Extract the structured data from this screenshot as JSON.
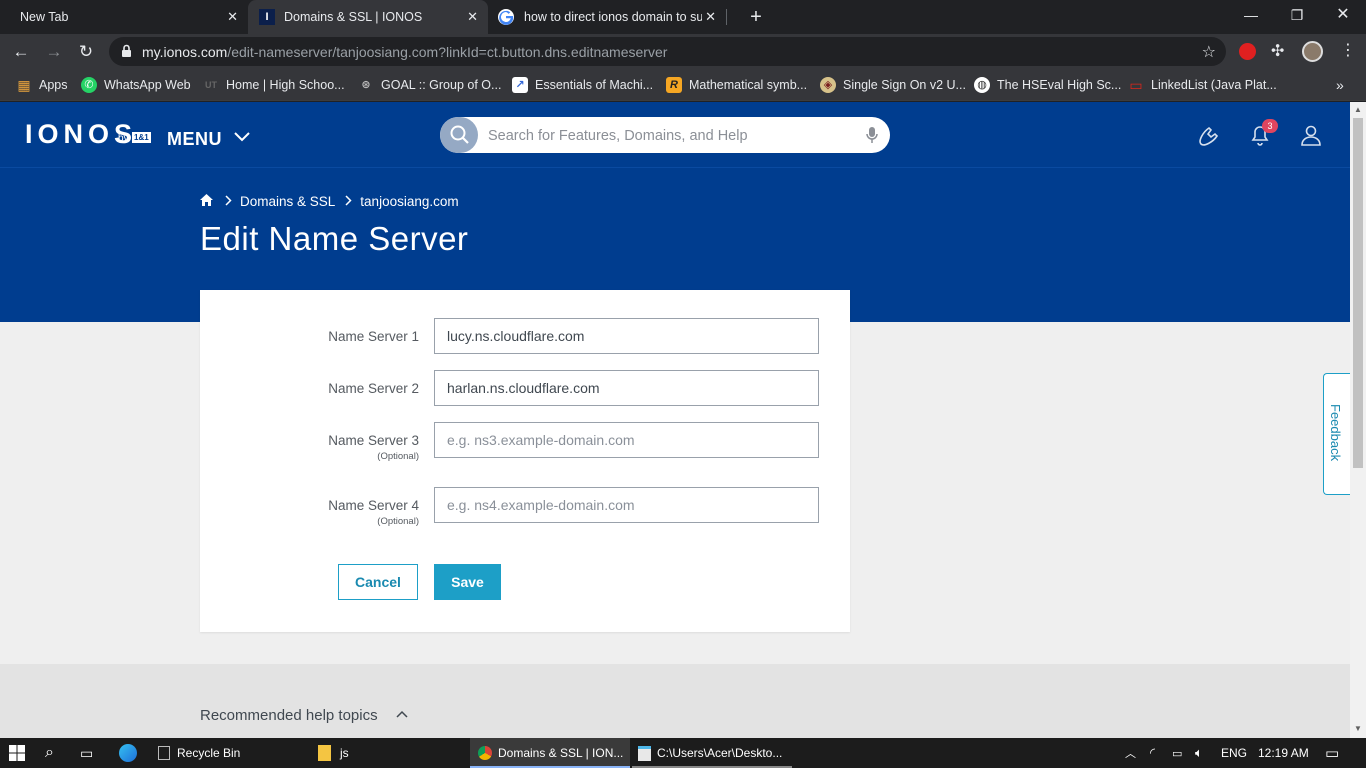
{
  "browser": {
    "tabs": [
      {
        "title": "New Tab"
      },
      {
        "title": "Domains & SSL | IONOS"
      },
      {
        "title": "how to direct ionos domain to su"
      }
    ],
    "url_host": "my.ionos.com",
    "url_path": "/edit-nameserver/tanjoosiang.com?linkId=ct.button.dns.editnameserver",
    "bookmarks": [
      "Apps",
      "WhatsApp Web",
      "Home | High Schoo...",
      "GOAL :: Group of O...",
      "Essentials of Machi...",
      "Mathematical symb...",
      "Single Sign On v2 U...",
      "The HSEval High Sc...",
      "LinkedList (Java Plat..."
    ]
  },
  "header": {
    "logo": "IONOS",
    "logo_by": "by",
    "logo_brand": "1&1",
    "menu_label": "MENU",
    "search_placeholder": "Search for Features, Domains, and Help",
    "notification_count": "3"
  },
  "breadcrumb": {
    "items": [
      "Domains & SSL",
      "tanjoosiang.com"
    ]
  },
  "page_title": "Edit Name Server",
  "form": {
    "fields": [
      {
        "label": "Name Server 1",
        "value": "lucy.ns.cloudflare.com",
        "placeholder": "",
        "optional": ""
      },
      {
        "label": "Name Server 2",
        "value": "harlan.ns.cloudflare.com",
        "placeholder": "",
        "optional": ""
      },
      {
        "label": "Name Server 3",
        "value": "",
        "placeholder": "e.g. ns3.example-domain.com",
        "optional": "(Optional)"
      },
      {
        "label": "Name Server 4",
        "value": "",
        "placeholder": "e.g. ns4.example-domain.com",
        "optional": "(Optional)"
      }
    ],
    "cancel_label": "Cancel",
    "save_label": "Save"
  },
  "help": {
    "title": "Recommended help topics"
  },
  "feedback_label": "Feedback",
  "taskbar": {
    "items": [
      "Recycle Bin",
      "js",
      "Domains & SSL | ION...",
      "C:\\Users\\Acer\\Deskto..."
    ],
    "language": "ENG",
    "time": "12:19 AM"
  },
  "colors": {
    "ionos_blue": "#003d8f",
    "accent": "#1d9fc7",
    "badge": "#e0455f"
  }
}
